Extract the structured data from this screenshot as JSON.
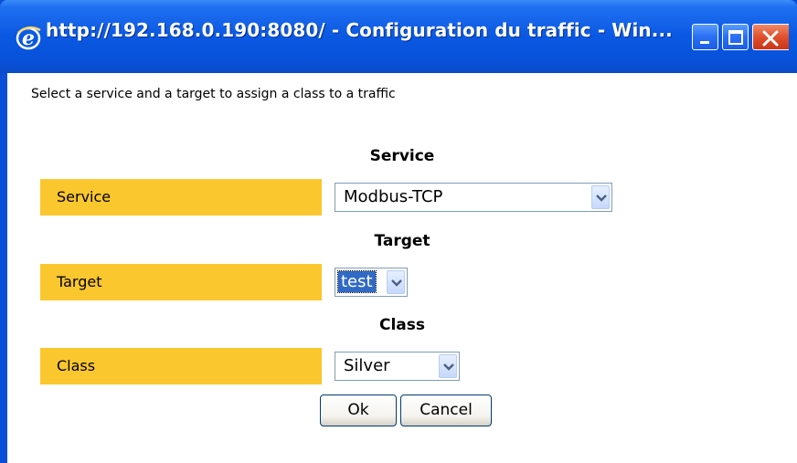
{
  "window": {
    "title": "http://192.168.0.190:8080/ - Configuration du traffic - Win...",
    "icon": "internet-explorer-icon"
  },
  "titlebar_buttons": {
    "minimize_icon": "minimize-icon",
    "maximize_icon": "maximize-icon",
    "close_icon": "close-icon"
  },
  "intro_text": "Select a service and a target to assign a class to a traffic",
  "sections": {
    "service": {
      "heading": "Service",
      "label": "Service",
      "selected": "Modbus-TCP"
    },
    "target": {
      "heading": "Target",
      "label": "Target",
      "selected": "test"
    },
    "class": {
      "heading": "Class",
      "label": "Class",
      "selected": "Silver"
    }
  },
  "buttons": {
    "ok_label": "Ok",
    "cancel_label": "Cancel"
  },
  "colors": {
    "label_background": "#fbc72f",
    "titlebar": "#0a58e2",
    "selection_highlight": "#316ac5"
  }
}
